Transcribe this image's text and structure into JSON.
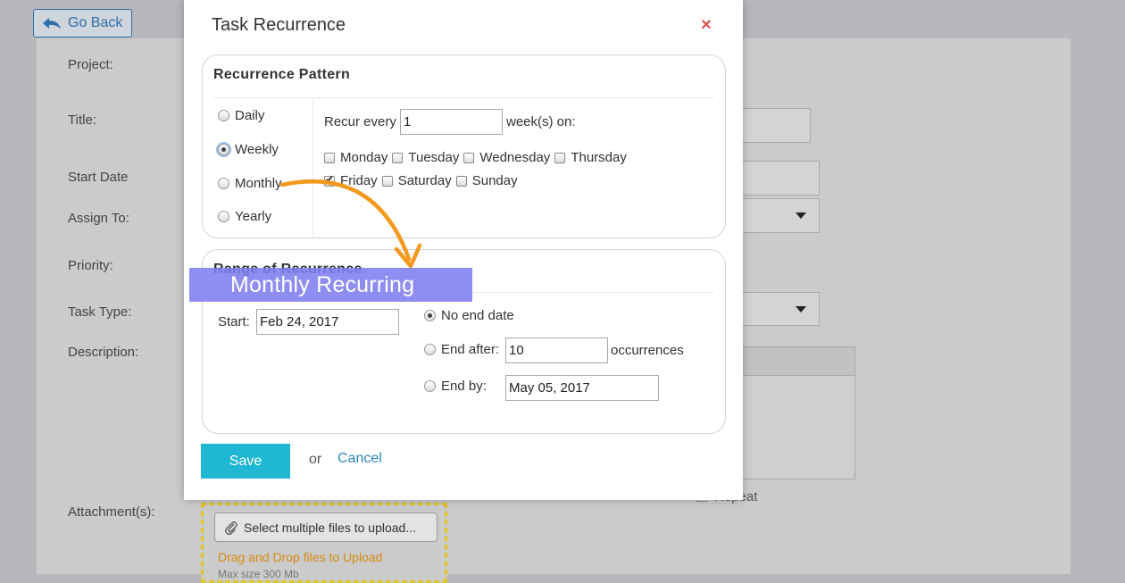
{
  "background": {
    "go_back_label": "Go Back",
    "labels": {
      "project": "Project:",
      "title": "Title:",
      "start_date": "Start Date",
      "assign_to": "Assign To:",
      "priority": "Priority:",
      "task_type": "Task Type:",
      "description": "Description:",
      "attachments": "Attachment(s):"
    },
    "repeat_label": "Repeat",
    "upload": {
      "button_label": "Select multiple files to upload...",
      "drag_drop_text": "Drag and Drop files to Upload",
      "max_size_text": "Max size 300 Mb"
    }
  },
  "modal": {
    "title": "Task Recurrence",
    "close_icon": "×",
    "recurrence_pattern": {
      "title": "Recurrence Pattern",
      "options": [
        {
          "label": "Daily",
          "checked": false
        },
        {
          "label": "Weekly",
          "checked": true
        },
        {
          "label": "Monthly",
          "checked": false
        },
        {
          "label": "Yearly",
          "checked": false
        }
      ],
      "recur_every_label": "Recur every",
      "recur_every_value": "1",
      "weeks_on_label": "week(s) on:",
      "days": [
        {
          "label": "Monday",
          "checked": false
        },
        {
          "label": "Tuesday",
          "checked": false
        },
        {
          "label": "Wednesday",
          "checked": false
        },
        {
          "label": "Thursday",
          "checked": false
        },
        {
          "label": "Friday",
          "checked": true
        },
        {
          "label": "Saturday",
          "checked": false
        },
        {
          "label": "Sunday",
          "checked": false
        }
      ]
    },
    "range_of_recurrence": {
      "title": "Range of Recurrence",
      "start_label": "Start:",
      "start_value": "Feb 24, 2017",
      "no_end_date_label": "No end date",
      "end_after_label": "End after:",
      "end_after_value": "10",
      "occurrences_label": "occurrences",
      "end_by_label": "End by:",
      "end_by_value": "May 05, 2017",
      "selected": "No end date"
    },
    "save_label": "Save",
    "or_text": "or",
    "cancel_label": "Cancel"
  },
  "annotation": {
    "callout_text": "Monthly Recurring",
    "arrow_color": "#f39a1e",
    "callout_color": "#7e7ef0"
  }
}
